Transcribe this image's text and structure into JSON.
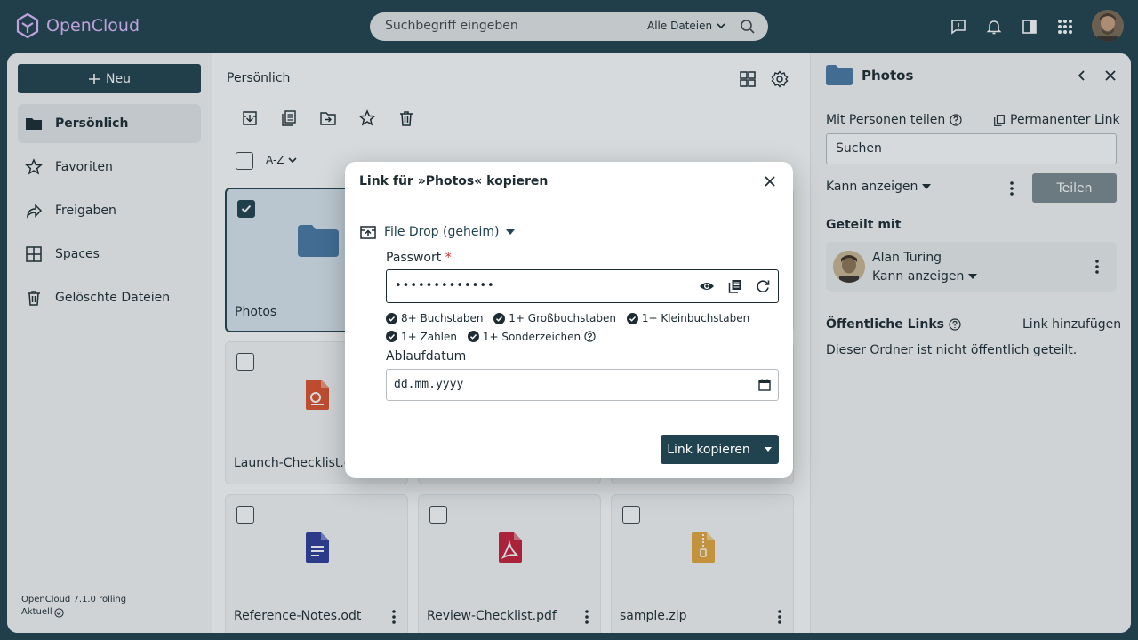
{
  "app": {
    "name": "OpenCloud",
    "version": "OpenCloud 7.1.0 rolling",
    "status": "Aktuell"
  },
  "search": {
    "placeholder": "Suchbegriff eingeben",
    "scope": "Alle Dateien"
  },
  "sidebar": {
    "new_label": "Neu",
    "items": [
      {
        "label": "Persönlich",
        "icon": "folder-icon",
        "active": true
      },
      {
        "label": "Favoriten",
        "icon": "star-icon"
      },
      {
        "label": "Freigaben",
        "icon": "share-icon"
      },
      {
        "label": "Spaces",
        "icon": "spaces-icon"
      },
      {
        "label": "Gelöschte Dateien",
        "icon": "trash-icon"
      }
    ]
  },
  "files": {
    "breadcrumb": "Persönlich",
    "sort_label": "A-Z",
    "tiles": [
      {
        "name": "Photos",
        "type": "folder",
        "selected": true
      },
      {
        "name": "Launch-Checklist.c",
        "type": "presentation"
      },
      {
        "name": "Reference-Notes.odt",
        "type": "document"
      },
      {
        "name": "Review-Checklist.pdf",
        "type": "pdf"
      },
      {
        "name": "sample.zip",
        "type": "archive"
      }
    ]
  },
  "panel": {
    "title": "Photos",
    "share_with_label": "Mit Personen teilen",
    "permanent_link": "Permanenter Link",
    "search_placeholder": "Suchen",
    "permission": "Kann anzeigen",
    "share_button": "Teilen",
    "shared_with_label": "Geteilt mit",
    "shared_user": {
      "name": "Alan Turing",
      "permission": "Kann anzeigen"
    },
    "public_links_label": "Öffentliche Links",
    "add_link": "Link hinzufügen",
    "no_public": "Dieser Ordner ist nicht öffentlich geteilt."
  },
  "dialog": {
    "title": "Link für »Photos« kopieren",
    "role": "File Drop (geheim)",
    "password_label": "Passwort",
    "password_required_mark": "*",
    "password_value": "•••••••••••••",
    "rules": [
      "8+ Buchstaben",
      "1+ Großbuchstaben",
      "1+ Kleinbuchstaben",
      "1+ Zahlen",
      "1+ Sonderzeichen"
    ],
    "expiry_label": "Ablaufdatum",
    "expiry_placeholder": "dd.mm.yyyy",
    "copy_button": "Link kopieren"
  },
  "colors": {
    "brand": "#20434f",
    "logo": "#e2baff",
    "folder": "#4a79a5",
    "pdf": "#c8203b",
    "presentation": "#e0542e",
    "document": "#2e3d9a",
    "archive": "#e6a83c"
  }
}
